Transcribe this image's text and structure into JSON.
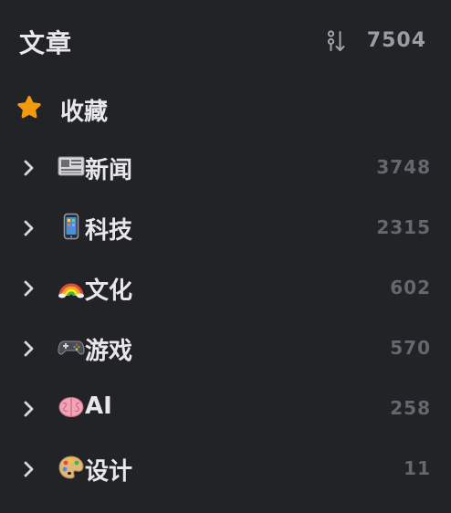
{
  "header": {
    "title": "文章",
    "total_count": "7504",
    "sort_icon": "sort-order-icon"
  },
  "favorites": {
    "label": "收藏",
    "icon": "star-icon",
    "icon_color": "#f59a0c"
  },
  "categories": [
    {
      "emoji": "newspaper-emoji",
      "label": "新闻",
      "count": "3748"
    },
    {
      "emoji": "mobile-phone-emoji",
      "label": "科技",
      "count": "2315"
    },
    {
      "emoji": "rainbow-emoji",
      "label": "文化",
      "count": "602"
    },
    {
      "emoji": "game-controller-emoji",
      "label": "游戏",
      "count": "570"
    },
    {
      "emoji": "brain-emoji",
      "label": "AI",
      "count": "258"
    },
    {
      "emoji": "artist-palette-emoji",
      "label": "设计",
      "count": "11"
    }
  ],
  "colors": {
    "background": "#222327",
    "text": "#e8e8ea",
    "count": "#66666d",
    "header_count": "#9c9ca3",
    "accent": "#f59a0c"
  }
}
